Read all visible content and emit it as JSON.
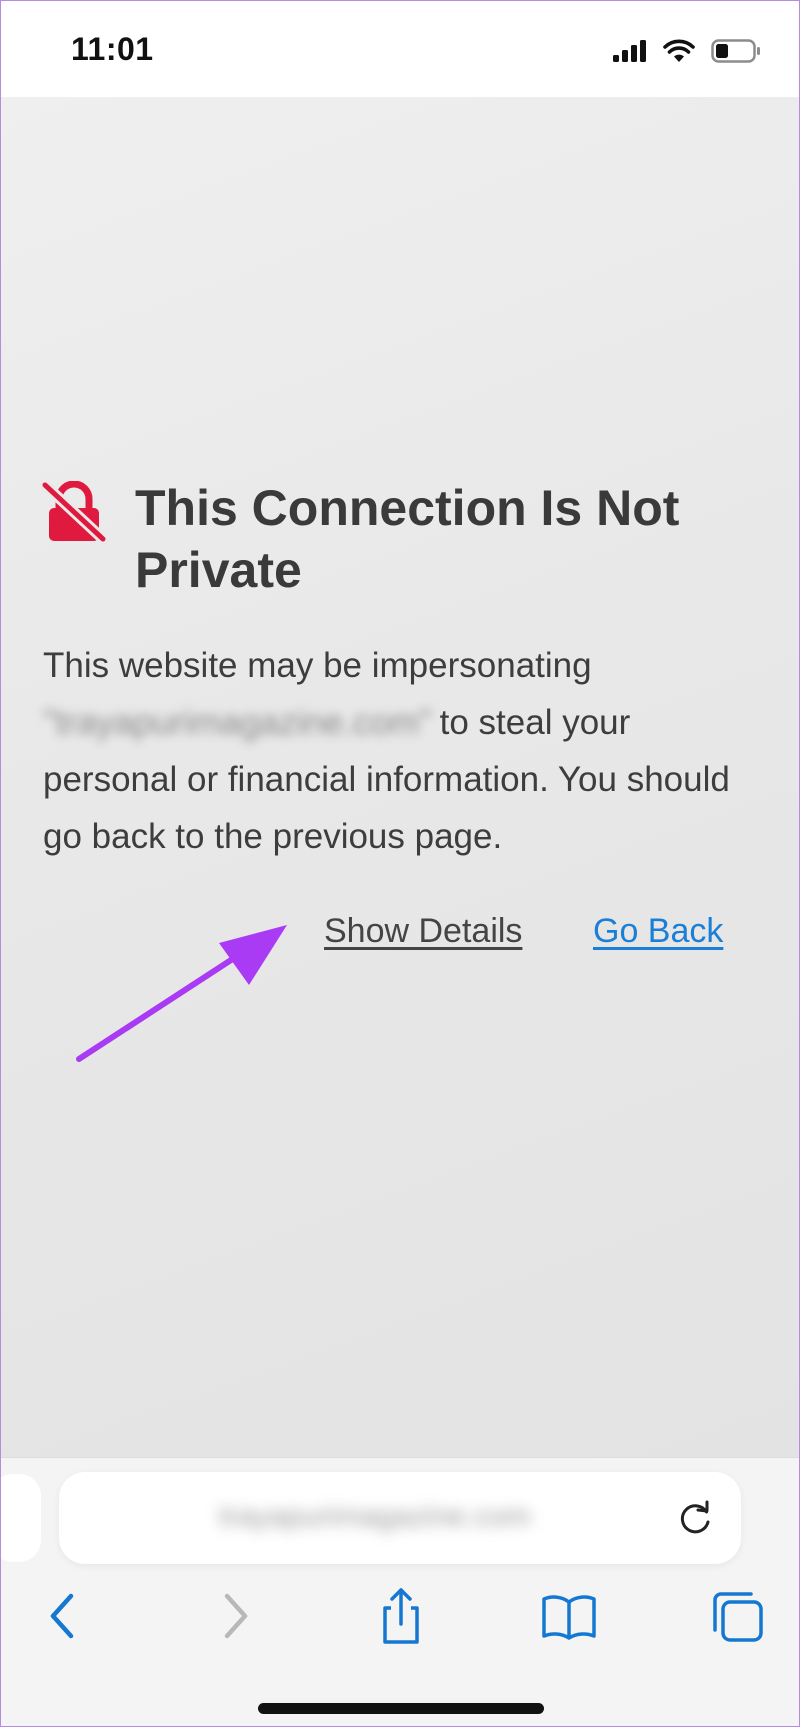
{
  "status_bar": {
    "time": "11:01",
    "icons": [
      "cellular-signal-icon",
      "wifi-icon",
      "battery-icon"
    ]
  },
  "warning": {
    "icon": "lock-slash-icon",
    "title": "This Connection Is Not Private",
    "message_start": "This website may be impersonating",
    "blurred_domain": "\"trayapurimagazine.com\"",
    "message_end": "to steal your personal or financial information. You should go back to the previous page."
  },
  "actions": {
    "show_details": "Show Details",
    "go_back": "Go Back"
  },
  "annotation": {
    "arrow_color": "#a93bf5"
  },
  "toolbar": {
    "address_text": "trayapurimagazine.com",
    "icons": [
      "back-icon",
      "forward-icon",
      "share-icon",
      "bookmarks-icon",
      "tabs-icon",
      "reload-icon"
    ]
  },
  "colors": {
    "warning_red": "#e0193f",
    "link_blue": "#1a7fd6",
    "ios_blue": "#1478d2",
    "disabled_gray": "#b8b8b8"
  }
}
